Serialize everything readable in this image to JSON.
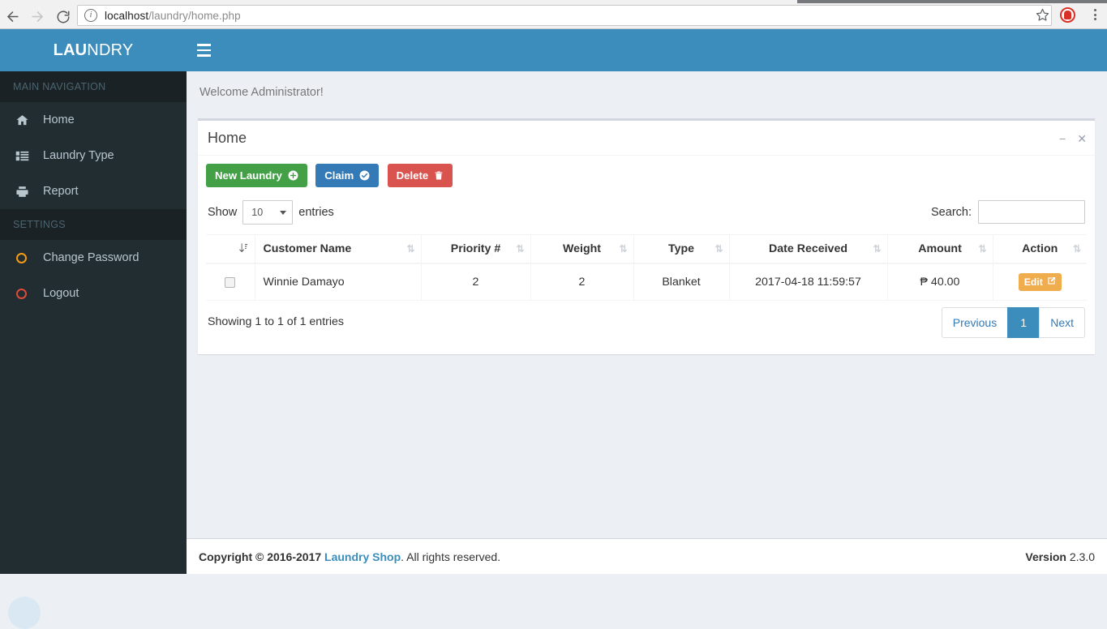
{
  "browser": {
    "url_host": "localhost",
    "url_path": "/laundry/home.php",
    "back_icon": "back-arrow-icon",
    "forward_icon": "forward-arrow-icon",
    "reload_icon": "reload-icon",
    "info_glyph": "i",
    "star_icon": "bookmark-star-icon",
    "extension_icon": "extension-icon",
    "menu_icon": "chrome-menu-icon"
  },
  "sidebar": {
    "logo": {
      "bold": "LAU",
      "light": "NDRY"
    },
    "sections": [
      {
        "header": "MAIN NAVIGATION",
        "items": [
          {
            "label": "Home",
            "icon": "home-icon"
          },
          {
            "label": "Laundry Type",
            "icon": "list-icon"
          },
          {
            "label": "Report",
            "icon": "printer-icon"
          }
        ]
      },
      {
        "header": "SETTINGS",
        "items": [
          {
            "label": "Change Password",
            "icon": "circle-orange-icon"
          },
          {
            "label": "Logout",
            "icon": "circle-red-icon"
          }
        ]
      }
    ]
  },
  "navbar": {
    "toggle_icon": "hamburger-icon"
  },
  "page": {
    "welcome": "Welcome Administrator!"
  },
  "box": {
    "title": "Home",
    "minimize_label": "−",
    "close_label": "✕",
    "actions": [
      {
        "label": "New Laundry",
        "icon": "plus-circle-icon",
        "style": "green"
      },
      {
        "label": "Claim",
        "icon": "check-circle-icon",
        "style": "blue"
      },
      {
        "label": "Delete",
        "icon": "trash-icon",
        "style": "red"
      }
    ]
  },
  "datatable": {
    "length_prefix": "Show",
    "length_value": "10",
    "length_suffix": "entries",
    "search_label": "Search:",
    "search_value": "",
    "search_placeholder": "",
    "columns": [
      {
        "label": "",
        "align": "center",
        "sort": "active"
      },
      {
        "label": "Customer Name",
        "align": "left",
        "sort": "none"
      },
      {
        "label": "Priority #",
        "align": "center",
        "sort": "none"
      },
      {
        "label": "Weight",
        "align": "center",
        "sort": "none"
      },
      {
        "label": "Type",
        "align": "center",
        "sort": "none"
      },
      {
        "label": "Date Received",
        "align": "center",
        "sort": "none"
      },
      {
        "label": "Amount",
        "align": "center",
        "sort": "none"
      },
      {
        "label": "Action",
        "align": "center",
        "sort": "none"
      }
    ],
    "rows": [
      {
        "selected": false,
        "customer_name": "Winnie Damayo",
        "priority": "2",
        "weight": "2",
        "type": "Blanket",
        "date_received": "2017-04-18 11:59:57",
        "amount": "₱ 40.00",
        "action_label": "Edit"
      }
    ],
    "info": "Showing 1 to 1 of 1 entries",
    "pagination": [
      {
        "label": "Previous",
        "active": false
      },
      {
        "label": "1",
        "active": true
      },
      {
        "label": "Next",
        "active": false
      }
    ]
  },
  "footer": {
    "copyright_prefix": "Copyright © 2016-2017",
    "company": "Laundry Shop",
    "copyright_suffix": ". All rights reserved.",
    "version_label": "Version",
    "version_number": "2.3.0"
  },
  "colors": {
    "brand_blue": "#3c8dbc",
    "sidebar_dark": "#222d32",
    "content_bg": "#ecf0f5",
    "green": "#43a047",
    "red": "#d9534f",
    "orange": "#f0ad4e"
  }
}
